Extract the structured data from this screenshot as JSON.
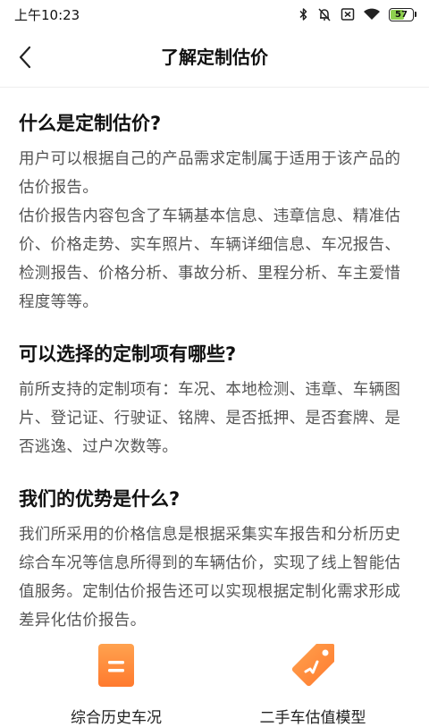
{
  "status_bar": {
    "time": "上午10:23",
    "battery_level": "57"
  },
  "nav": {
    "title": "了解定制估价"
  },
  "sections": [
    {
      "title": "什么是定制估价?",
      "paragraphs": [
        "用户可以根据自己的产品需求定制属于适用于该产品的估价报告。",
        "估价报告内容包含了车辆基本信息、违章信息、精准估价、价格走势、实车照片、车辆详细信息、车况报告、检测报告、价格分析、事故分析、里程分析、车主爱惜程度等等。"
      ]
    },
    {
      "title": "可以选择的定制项有哪些?",
      "paragraphs": [
        "前所支持的定制项有：车况、本地检测、违章、车辆图片、登记证、行驶证、铭牌、是否抵押、是否套牌、是否逃逸、过户次数等。"
      ]
    },
    {
      "title": "我们的优势是什么?",
      "paragraphs": [
        "我们所采用的价格信息是根据采集实车报告和分析历史综合车况等信息所得到的车辆估价，实现了线上智能估值服务。定制估价报告还可以实现根据定制化需求形成差异化估价报告。"
      ]
    }
  ],
  "features": [
    {
      "label": "综合历史车况",
      "icon": "document-icon"
    },
    {
      "label": "二手车估值模型",
      "icon": "price-tag-icon"
    }
  ],
  "colors": {
    "accent": "#ff7a2e",
    "accent_light": "#ffa24f",
    "title_text": "#111111",
    "body_text": "#555555"
  }
}
